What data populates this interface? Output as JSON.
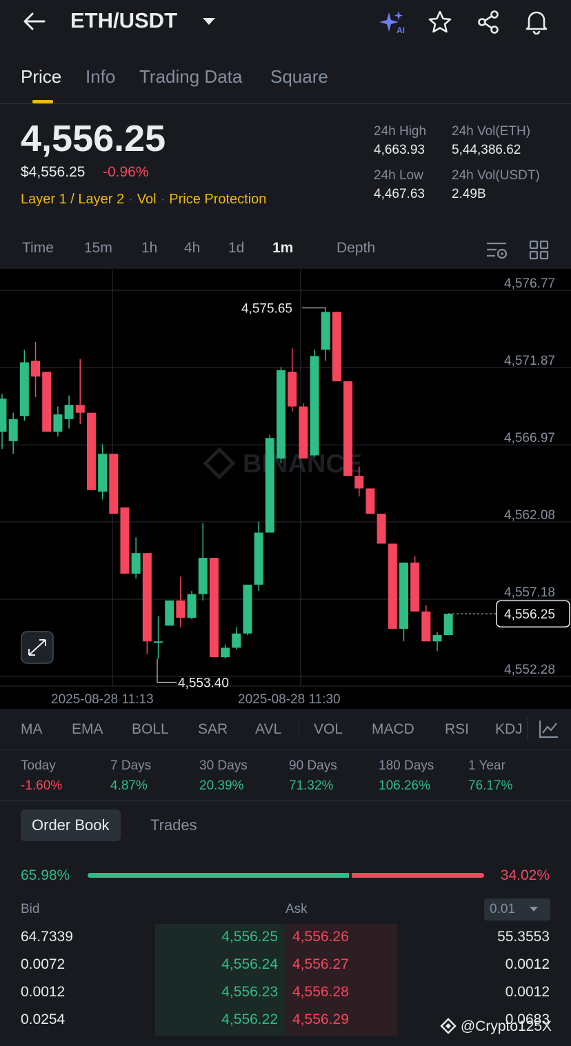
{
  "header": {
    "pair": "ETH/USDT",
    "icons": [
      "back-arrow-icon",
      "caret-down-icon",
      "ai-sparkle-icon",
      "star-icon",
      "share-icon",
      "bell-icon"
    ]
  },
  "tabs": [
    {
      "label": "Price",
      "active": true
    },
    {
      "label": "Info",
      "active": false
    },
    {
      "label": "Trading Data",
      "active": false
    },
    {
      "label": "Square",
      "active": false
    }
  ],
  "ticker": {
    "last_price": "4,556.25",
    "usd_price": "$4,556.25",
    "change_pct": "-0.96%",
    "tags": [
      "Layer 1 / Layer 2",
      "Vol",
      "Price Protection"
    ],
    "high_label": "24h High",
    "high_value": "4,663.93",
    "vol_eth_label": "24h Vol(ETH)",
    "vol_eth_value": "5,44,386.62",
    "low_label": "24h Low",
    "low_value": "4,467.63",
    "vol_usdt_label": "24h Vol(USDT)",
    "vol_usdt_value": "2.49B"
  },
  "intervals": {
    "items": [
      "Time",
      "15m",
      "1h",
      "4h",
      "1d",
      "1m",
      "Depth"
    ],
    "active": "1m"
  },
  "chart_data": {
    "type": "candlestick",
    "title": "",
    "watermark": "BINANCE",
    "y_ticks": [
      "4,576.77",
      "4,571.87",
      "4,566.97",
      "4,562.08",
      "4,557.18",
      "4,552.28"
    ],
    "x_ticks": [
      "2025-08-28 11:13",
      "2025-08-28 11:30"
    ],
    "ylim": [
      4552.28,
      4576.77
    ],
    "current_price": "4,556.25",
    "current_value": 4556.25,
    "high_marker": "4,575.65",
    "high_value": 4575.65,
    "low_marker": "4,553.40",
    "low_value": 4553.4,
    "candles": [
      {
        "o": 4567.8,
        "h": 4570.2,
        "l": 4566.7,
        "c": 4569.9
      },
      {
        "o": 4567.2,
        "h": 4569.0,
        "l": 4566.4,
        "c": 4568.6
      },
      {
        "o": 4568.8,
        "h": 4573.0,
        "l": 4568.5,
        "c": 4572.2
      },
      {
        "o": 4572.3,
        "h": 4573.5,
        "l": 4570.0,
        "c": 4571.3
      },
      {
        "o": 4571.6,
        "h": 4571.6,
        "l": 4567.8,
        "c": 4567.8
      },
      {
        "o": 4567.8,
        "h": 4569.4,
        "l": 4567.5,
        "c": 4568.9
      },
      {
        "o": 4568.6,
        "h": 4570.1,
        "l": 4568.0,
        "c": 4569.5
      },
      {
        "o": 4569.5,
        "h": 4572.4,
        "l": 4568.3,
        "c": 4569.0
      },
      {
        "o": 4569.0,
        "h": 4569.0,
        "l": 4564.1,
        "c": 4564.1
      },
      {
        "o": 4564.0,
        "h": 4567.0,
        "l": 4563.5,
        "c": 4566.4
      },
      {
        "o": 4566.4,
        "h": 4566.4,
        "l": 4562.6,
        "c": 4562.6
      },
      {
        "o": 4563.0,
        "h": 4563.0,
        "l": 4558.8,
        "c": 4558.8
      },
      {
        "o": 4558.8,
        "h": 4561.1,
        "l": 4558.5,
        "c": 4560.1
      },
      {
        "o": 4560.1,
        "h": 4560.1,
        "l": 4553.7,
        "c": 4554.5
      },
      {
        "o": 4554.5,
        "h": 4556.1,
        "l": 4553.4,
        "c": 4554.5
      },
      {
        "o": 4555.5,
        "h": 4557.1,
        "l": 4555.5,
        "c": 4557.1
      },
      {
        "o": 4557.1,
        "h": 4558.6,
        "l": 4555.4,
        "c": 4556.0
      },
      {
        "o": 4556.0,
        "h": 4557.7,
        "l": 4555.9,
        "c": 4557.5
      },
      {
        "o": 4557.5,
        "h": 4562.0,
        "l": 4557.1,
        "c": 4559.8
      },
      {
        "o": 4559.8,
        "h": 4559.8,
        "l": 4553.5,
        "c": 4553.5
      },
      {
        "o": 4553.5,
        "h": 4554.3,
        "l": 4553.4,
        "c": 4554.1
      },
      {
        "o": 4554.1,
        "h": 4555.4,
        "l": 4554.0,
        "c": 4555.0
      },
      {
        "o": 4555.0,
        "h": 4558.1,
        "l": 4554.9,
        "c": 4558.1
      },
      {
        "o": 4558.1,
        "h": 4562.1,
        "l": 4557.7,
        "c": 4561.4
      },
      {
        "o": 4561.4,
        "h": 4567.6,
        "l": 4561.4,
        "c": 4567.4
      },
      {
        "o": 4566.1,
        "h": 4571.9,
        "l": 4565.8,
        "c": 4571.7
      },
      {
        "o": 4571.6,
        "h": 4573.1,
        "l": 4569.1,
        "c": 4569.4
      },
      {
        "o": 4569.4,
        "h": 4569.6,
        "l": 4566.1,
        "c": 4566.1
      },
      {
        "o": 4566.3,
        "h": 4573.0,
        "l": 4566.2,
        "c": 4572.6
      },
      {
        "o": 4573.0,
        "h": 4575.65,
        "l": 4572.3,
        "c": 4575.4
      },
      {
        "o": 4575.4,
        "h": 4575.4,
        "l": 4571.0,
        "c": 4571.0
      },
      {
        "o": 4571.0,
        "h": 4571.0,
        "l": 4565.0,
        "c": 4565.0
      },
      {
        "o": 4565.0,
        "h": 4565.6,
        "l": 4563.7,
        "c": 4564.2
      },
      {
        "o": 4564.2,
        "h": 4564.2,
        "l": 4562.6,
        "c": 4562.6
      },
      {
        "o": 4562.6,
        "h": 4562.6,
        "l": 4560.7,
        "c": 4560.7
      },
      {
        "o": 4560.7,
        "h": 4560.7,
        "l": 4555.3,
        "c": 4555.3
      },
      {
        "o": 4555.3,
        "h": 4559.5,
        "l": 4554.5,
        "c": 4559.5
      },
      {
        "o": 4559.5,
        "h": 4559.9,
        "l": 4556.5,
        "c": 4556.4
      },
      {
        "o": 4556.4,
        "h": 4556.8,
        "l": 4554.6,
        "c": 4554.5
      },
      {
        "o": 4554.5,
        "h": 4555.1,
        "l": 4553.9,
        "c": 4554.9
      },
      {
        "o": 4554.9,
        "h": 4555.3,
        "l": 4555.0,
        "c": 4556.25
      }
    ]
  },
  "indicators": [
    "MA",
    "EMA",
    "BOLL",
    "SAR",
    "AVL",
    "VOL",
    "MACD",
    "RSI",
    "KDJ"
  ],
  "performance": [
    {
      "label": "Today",
      "value": "-1.60%",
      "color": "#f6465d"
    },
    {
      "label": "7 Days",
      "value": "4.87%",
      "color": "#2ebd85"
    },
    {
      "label": "30 Days",
      "value": "20.39%",
      "color": "#2ebd85"
    },
    {
      "label": "90 Days",
      "value": "71.32%",
      "color": "#2ebd85"
    },
    {
      "label": "180 Days",
      "value": "106.26%",
      "color": "#2ebd85"
    },
    {
      "label": "1 Year",
      "value": "76.17%",
      "color": "#2ebd85"
    }
  ],
  "orderbook": {
    "tabs": [
      "Order Book",
      "Trades"
    ],
    "bid_ratio": "65.98%",
    "ask_ratio": "34.02%",
    "bid_ratio_value": 0.6598,
    "bid_label": "Bid",
    "ask_label": "Ask",
    "precision": "0.01",
    "rows": [
      {
        "bid_qty": "64.7339",
        "bid_price": "4,556.25",
        "ask_price": "4,556.26",
        "ask_qty": "55.3553"
      },
      {
        "bid_qty": "0.0072",
        "bid_price": "4,556.24",
        "ask_price": "4,556.27",
        "ask_qty": "0.0012"
      },
      {
        "bid_qty": "0.0012",
        "bid_price": "4,556.23",
        "ask_price": "4,556.28",
        "ask_qty": "0.0012"
      },
      {
        "bid_qty": "0.0254",
        "bid_price": "4,556.22",
        "ask_price": "4,556.29",
        "ask_qty": "0.0683"
      }
    ]
  },
  "watermark": "@Crypto125X",
  "colors": {
    "up": "#2ebd85",
    "down": "#f6465d",
    "accent": "#f0b90b",
    "bg": "#181a20"
  }
}
